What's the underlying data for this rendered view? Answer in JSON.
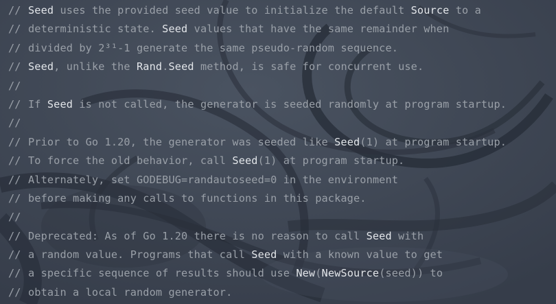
{
  "comment_prefix": "//",
  "colors": {
    "background": "#3d4553",
    "comment_text": "#9aa0a8",
    "identifier_text": "#e3e6ea"
  },
  "lines": [
    [
      {
        "t": "Seed",
        "k": 1
      },
      {
        "t": " uses the provided seed value to initialize the default "
      },
      {
        "t": "Source",
        "k": 1
      },
      {
        "t": " to a"
      }
    ],
    [
      {
        "t": "deterministic state. "
      },
      {
        "t": "Seed",
        "k": 1
      },
      {
        "t": " values that have the same remainder when"
      }
    ],
    [
      {
        "t": "divided by 2³¹-1 generate the same pseudo-random sequence."
      }
    ],
    [
      {
        "t": "Seed",
        "k": 1
      },
      {
        "t": ", unlike the "
      },
      {
        "t": "Rand",
        "k": 1
      },
      {
        "t": "."
      },
      {
        "t": "Seed",
        "k": 1
      },
      {
        "t": " method, is safe for concurrent use."
      }
    ],
    [],
    [
      {
        "t": "If "
      },
      {
        "t": "Seed",
        "k": 1
      },
      {
        "t": " is not called, the generator is seeded randomly at program startup."
      }
    ],
    [],
    [
      {
        "t": "Prior to Go 1.20, the generator was seeded like "
      },
      {
        "t": "Seed",
        "k": 1
      },
      {
        "t": "(1) at program startup."
      }
    ],
    [
      {
        "t": "To force the old behavior, call "
      },
      {
        "t": "Seed",
        "k": 1
      },
      {
        "t": "(1) at program startup."
      }
    ],
    [
      {
        "t": "Alternately, set GODEBUG=randautoseed=0 in the environment"
      }
    ],
    [
      {
        "t": "before making any calls to functions in this package."
      }
    ],
    [],
    [
      {
        "t": "Deprecated: As of Go 1.20 there is no reason to call "
      },
      {
        "t": "Seed",
        "k": 1
      },
      {
        "t": " with"
      }
    ],
    [
      {
        "t": "a random value. Programs that call "
      },
      {
        "t": "Seed",
        "k": 1
      },
      {
        "t": " with a known value to get"
      }
    ],
    [
      {
        "t": "a specific sequence of results should use "
      },
      {
        "t": "New",
        "k": 1
      },
      {
        "t": "("
      },
      {
        "t": "NewSource",
        "k": 1
      },
      {
        "t": "(seed)) to"
      }
    ],
    [
      {
        "t": "obtain a local random generator."
      }
    ]
  ]
}
